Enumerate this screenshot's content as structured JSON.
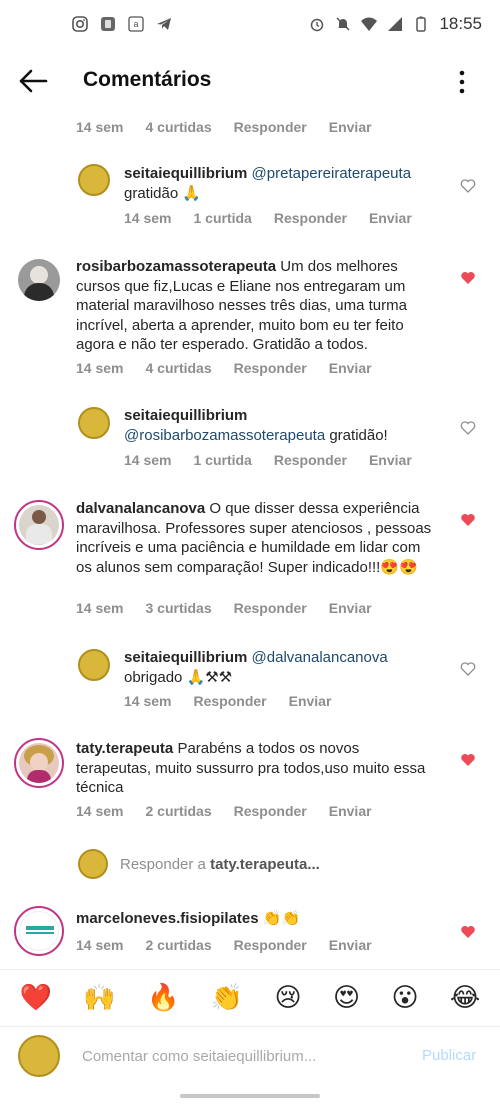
{
  "status": {
    "time": "18:55"
  },
  "header": {
    "title": "Comentários"
  },
  "comments": [
    {
      "id": "c0",
      "time": "14 sem",
      "likes": "4 curtidas",
      "reply": "Responder",
      "send": "Enviar"
    },
    {
      "id": "r1",
      "user": "seitaiequillibrium",
      "mention": "@pretapereiraterapeuta",
      "text": "gratidão 🙏",
      "time": "14 sem",
      "likes": "1 curtida",
      "reply": "Responder",
      "send": "Enviar",
      "liked": false
    },
    {
      "id": "c2",
      "user": "rosibarbozamassoterapeuta",
      "text": "Um dos melhores cursos que fiz,Lucas e Eliane nos entregaram um material maravilhoso nesses três dias, uma turma incrível, aberta a aprender, muito bom eu ter feito agora e não ter esperado. Gratidão a todos.",
      "time": "14 sem",
      "likes": "4 curtidas",
      "reply": "Responder",
      "send": "Enviar",
      "liked": true
    },
    {
      "id": "r3",
      "user": "seitaiequillibrium",
      "mention": "@rosibarbozamassoterapeuta",
      "text": "gratidão!",
      "time": "14 sem",
      "likes": "1 curtida",
      "reply": "Responder",
      "send": "Enviar",
      "liked": false
    },
    {
      "id": "c4",
      "user": "dalvanalancanova",
      "text": "O que disser dessa experiência maravilhosa.  Professores super atenciosos , pessoas incríveis e uma paciência e humildade em lidar com os alunos sem comparação! Super indicado!!!😍😍",
      "time": "14 sem",
      "likes": "3 curtidas",
      "reply": "Responder",
      "send": "Enviar",
      "liked": true
    },
    {
      "id": "r5",
      "user": "seitaiequillibrium",
      "mention": "@dalvanalancanova",
      "text": "obrigado 🙏⚒⚒",
      "time": "14 sem",
      "reply": "Responder",
      "send": "Enviar",
      "liked": false
    },
    {
      "id": "c6",
      "user": "taty.terapeuta",
      "text": "Parabéns  a todos  os novos terapeutas, muito sussurro  pra todos,uso muito essa técnica",
      "time": "14 sem",
      "likes": "2 curtidas",
      "reply": "Responder",
      "send": "Enviar",
      "liked": true
    },
    {
      "id": "c7",
      "user": "marceloneves.fisiopilates",
      "text": "👏👏",
      "time": "14 sem",
      "likes": "2 curtidas",
      "reply": "Responder",
      "send": "Enviar",
      "liked": true
    }
  ],
  "reply_bar": {
    "prefix": "Responder a",
    "target": "taty.terapeuta..."
  },
  "emojis": [
    "❤️",
    "🙌",
    "🔥",
    "👏",
    "😢",
    "😍",
    "😮",
    "😂"
  ],
  "input": {
    "placeholder": "Comentar como seitaiequillibrium...",
    "publish": "Publicar"
  },
  "colors": {
    "heart": "#ed4956",
    "publish": "#b3dbff",
    "seal": "#d8b73a"
  }
}
